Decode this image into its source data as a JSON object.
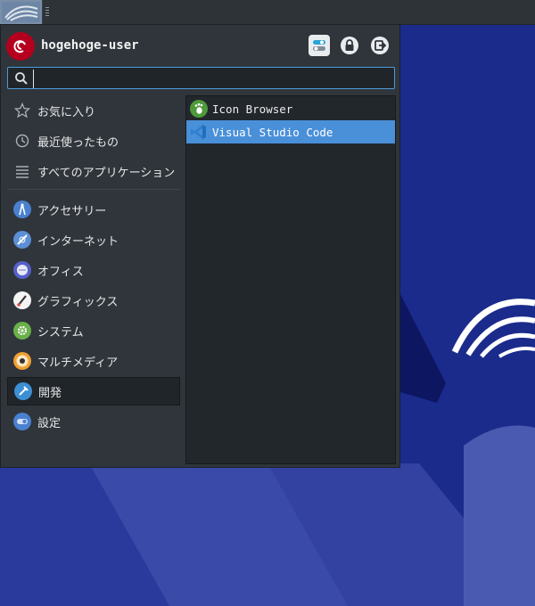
{
  "panel": {
    "launcher_icon": "debian-swirl-icon"
  },
  "menu": {
    "username": "hogehoge-user",
    "avatar_icon": "debian-logo-icon",
    "header_buttons": [
      {
        "name": "settings-toggle-icon"
      },
      {
        "name": "lock-icon"
      },
      {
        "name": "logout-icon"
      }
    ],
    "search": {
      "value": "",
      "placeholder": ""
    },
    "categories_top": [
      {
        "label": "お気に入り",
        "icon": "star-icon"
      },
      {
        "label": "最近使ったもの",
        "icon": "clock-icon"
      },
      {
        "label": "すべてのアプリケーション",
        "icon": "list-icon"
      }
    ],
    "categories": [
      {
        "label": "アクセサリー",
        "icon": "accessories-icon",
        "color": "#4a80d0"
      },
      {
        "label": "インターネット",
        "icon": "internet-icon",
        "color": "#5b8fd6"
      },
      {
        "label": "オフィス",
        "icon": "office-icon",
        "color": "#5560c8"
      },
      {
        "label": "グラフィックス",
        "icon": "graphics-icon",
        "color": "#ffffff"
      },
      {
        "label": "システム",
        "icon": "system-icon",
        "color": "#6bb04b"
      },
      {
        "label": "マルチメディア",
        "icon": "multimedia-icon",
        "color": "#f0a030"
      },
      {
        "label": "開発",
        "icon": "development-icon",
        "color": "#3d8fd4",
        "selected": true
      },
      {
        "label": "設定",
        "icon": "settings-icon",
        "color": "#4a80d0"
      }
    ],
    "apps": [
      {
        "label": "Icon Browser",
        "icon": "gnome-foot-icon",
        "color": "#4e9a3a"
      },
      {
        "label": "Visual Studio Code",
        "icon": "vscode-icon",
        "color": "#2f80d1",
        "selected": true
      }
    ]
  },
  "colors": {
    "accent": "#4a90d9",
    "menu_bg": "#2f353b",
    "desktop_bg": "#1a2a8a"
  }
}
